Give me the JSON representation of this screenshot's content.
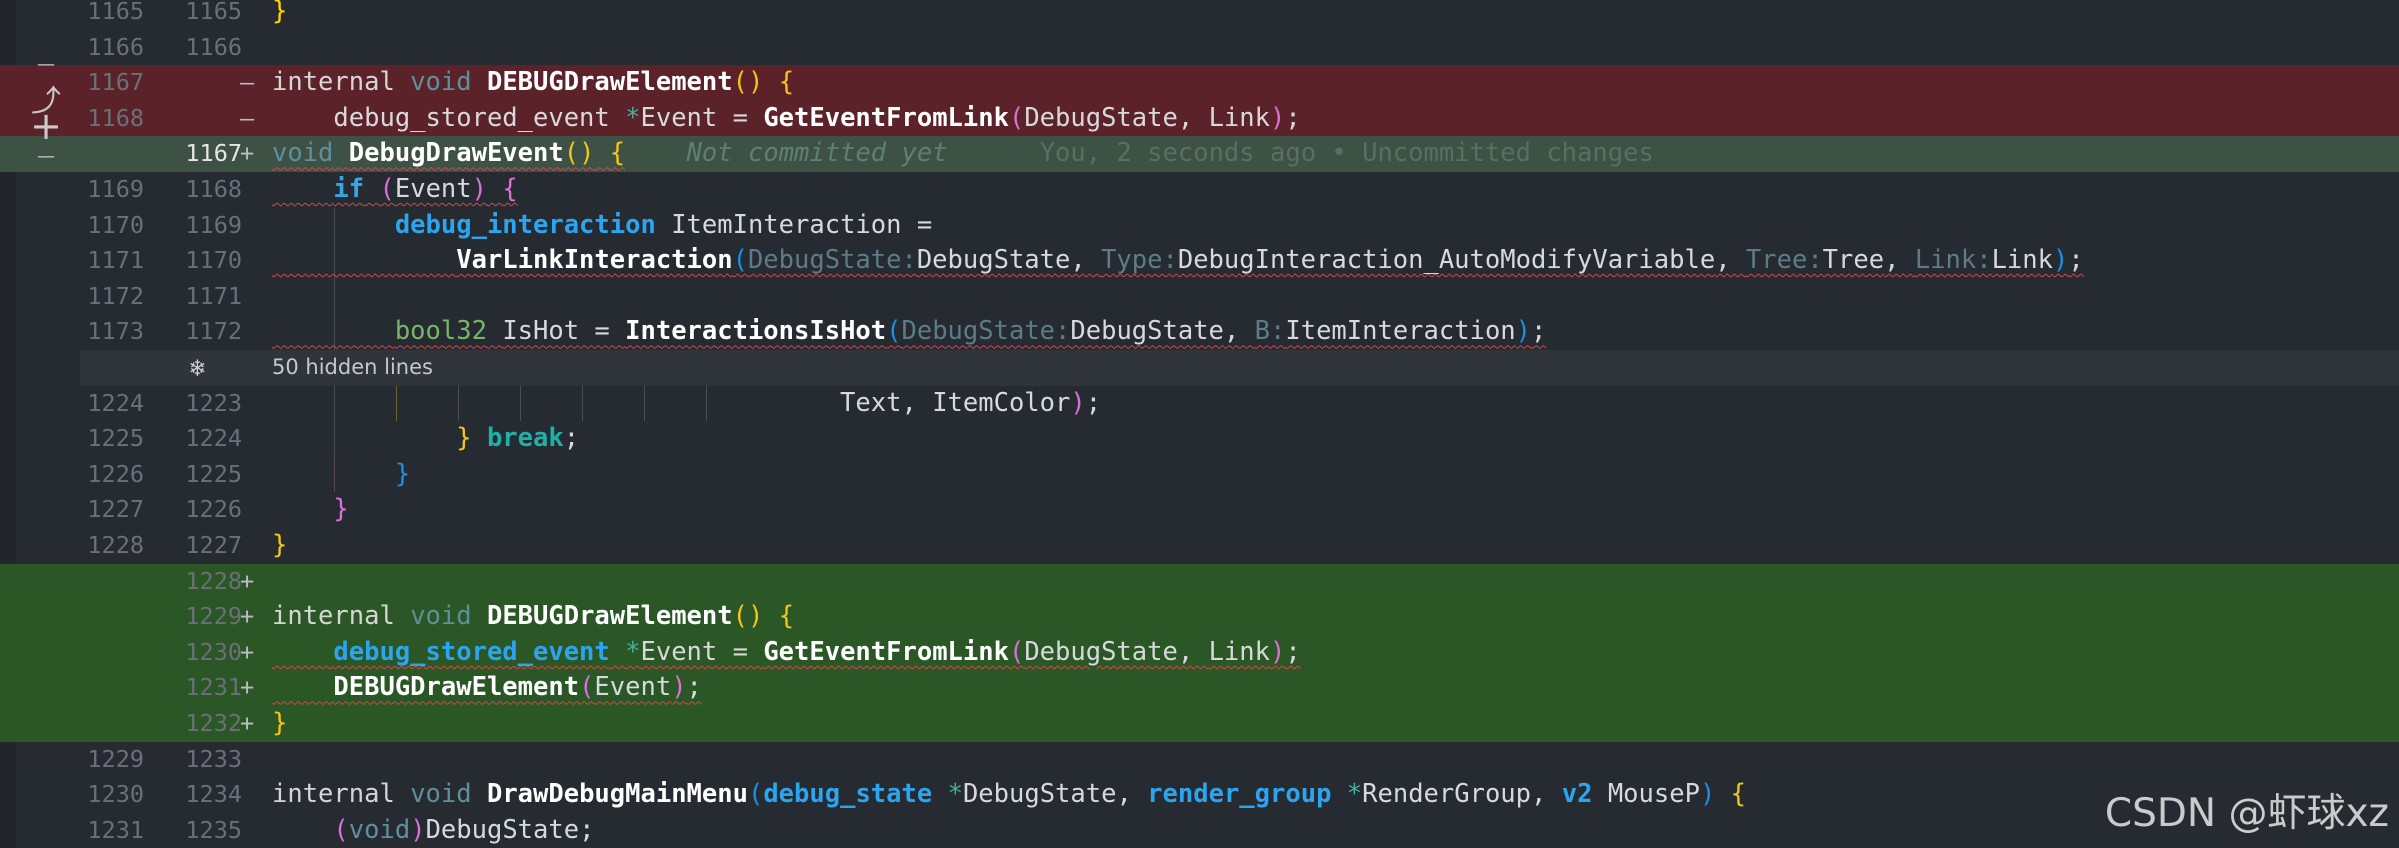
{
  "diff": {
    "lines": [
      {
        "old": "1165",
        "new": "1165",
        "marker": "",
        "kind": "ctx"
      },
      {
        "old": "1166",
        "new": "1166",
        "marker": "",
        "kind": "ctx"
      },
      {
        "old": "1167",
        "new": "",
        "marker": "—",
        "kind": "del"
      },
      {
        "old": "1168",
        "new": "",
        "marker": "—",
        "kind": "del"
      },
      {
        "old": "",
        "new": "1167",
        "marker": "+",
        "kind": "add-hl"
      },
      {
        "old": "1169",
        "new": "1168",
        "marker": "",
        "kind": "ctx"
      },
      {
        "old": "1170",
        "new": "1169",
        "marker": "",
        "kind": "ctx"
      },
      {
        "old": "1171",
        "new": "1170",
        "marker": "",
        "kind": "ctx"
      },
      {
        "old": "1172",
        "new": "1171",
        "marker": "",
        "kind": "ctx"
      },
      {
        "old": "1173",
        "new": "1172",
        "marker": "",
        "kind": "ctx"
      },
      {
        "old": "",
        "new": "",
        "marker": "",
        "kind": "hidden"
      },
      {
        "old": "1224",
        "new": "1223",
        "marker": "",
        "kind": "ctx"
      },
      {
        "old": "1225",
        "new": "1224",
        "marker": "",
        "kind": "ctx"
      },
      {
        "old": "1226",
        "new": "1225",
        "marker": "",
        "kind": "ctx"
      },
      {
        "old": "1227",
        "new": "1226",
        "marker": "",
        "kind": "ctx"
      },
      {
        "old": "1228",
        "new": "1227",
        "marker": "",
        "kind": "ctx"
      },
      {
        "old": "",
        "new": "1228",
        "marker": "+",
        "kind": "add"
      },
      {
        "old": "",
        "new": "1229",
        "marker": "+",
        "kind": "add"
      },
      {
        "old": "",
        "new": "1230",
        "marker": "+",
        "kind": "add"
      },
      {
        "old": "",
        "new": "1231",
        "marker": "+",
        "kind": "add"
      },
      {
        "old": "",
        "new": "1232",
        "marker": "+",
        "kind": "add"
      },
      {
        "old": "1229",
        "new": "1233",
        "marker": "",
        "kind": "ctx"
      },
      {
        "old": "1230",
        "new": "1234",
        "marker": "",
        "kind": "ctx"
      },
      {
        "old": "1231",
        "new": "1235",
        "marker": "",
        "kind": "ctx"
      }
    ]
  },
  "tokens": {
    "brace_close": "}",
    "brace_open": "{",
    "kw_internal": "internal",
    "kw_void": "void",
    "kw_if": "if",
    "kw_break": "break",
    "fn_debugdrawelement": "DEBUGDrawElement",
    "fn_debugdrawevent": "DebugDrawEvent",
    "fn_geteventfromlink": "GetEventFromLink",
    "fn_varlinkinteraction": "VarLinkInteraction",
    "fn_interactionsishot": "InteractionsIsHot",
    "fn_drawdebugmainmenu": "DrawDebugMainMenu",
    "ty_debug_stored_event": "debug_stored_event",
    "ty_debug_interaction": "debug_interaction",
    "ty_bool32": "bool32",
    "ty_debug_state": "debug_state",
    "ty_render_group": "render_group",
    "ty_v2": "v2",
    "star": "*",
    "id_event": "Event",
    "id_debugstate": "DebugState",
    "id_link": "Link",
    "id_iteminteraction": "ItemInteraction",
    "id_debuginteraction_automodify": "DebugInteraction_AutoModifyVariable",
    "id_tree": "Tree",
    "id_ishot": "IsHot",
    "id_text": "Text",
    "id_itemcolor": "ItemColor",
    "id_rendergroup": "RenderGroup",
    "id_mousep": "MouseP",
    "hint_debugstate": "DebugState:",
    "hint_type": "Type:",
    "hint_tree": "Tree:",
    "hint_link": "Link:",
    "hint_b": "B:"
  },
  "blame": {
    "note": "Not committed yet",
    "detail": "You, 2 seconds ago • Uncommitted changes"
  },
  "hidden_lines": {
    "label": "50 hidden lines",
    "icon": "snowflake-icon"
  },
  "actions": {
    "top_marker": "—",
    "revert_glyph": "⤴",
    "stage_glyph": "+",
    "bottom_marker": "—"
  },
  "watermark": "CSDN @虾球xz",
  "colors": {
    "background": "#262a31",
    "deleted": "#5b2329",
    "added": "#2a5725",
    "added_current": "#3e5145"
  }
}
